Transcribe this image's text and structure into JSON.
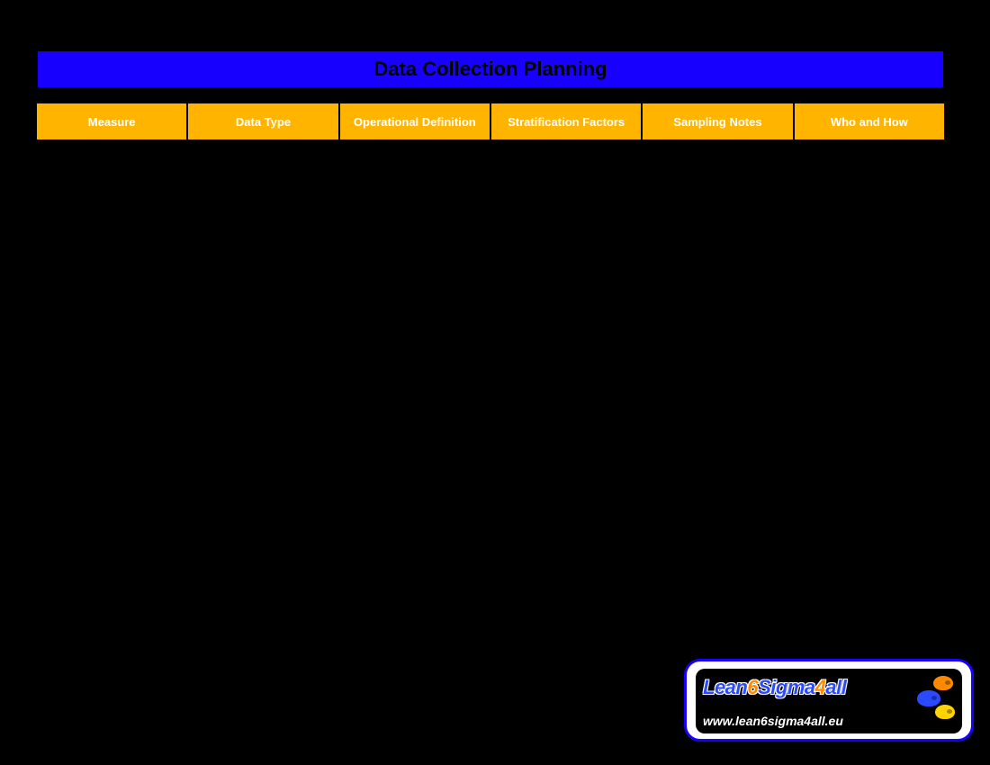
{
  "title": "Data Collection Planning",
  "columns": [
    "Measure",
    "Data Type",
    "Operational Definition",
    "Stratification Factors",
    "Sampling Notes",
    "Who and How"
  ],
  "logo": {
    "parts": [
      {
        "text": "Lean",
        "cls": "lt-blue"
      },
      {
        "text": "6",
        "cls": "lt-orange"
      },
      {
        "text": "Sigma",
        "cls": "lt-blue"
      },
      {
        "text": "4",
        "cls": "lt-orange"
      },
      {
        "text": "all",
        "cls": "lt-blue"
      }
    ],
    "url": "www.lean6sigma4all.eu"
  }
}
